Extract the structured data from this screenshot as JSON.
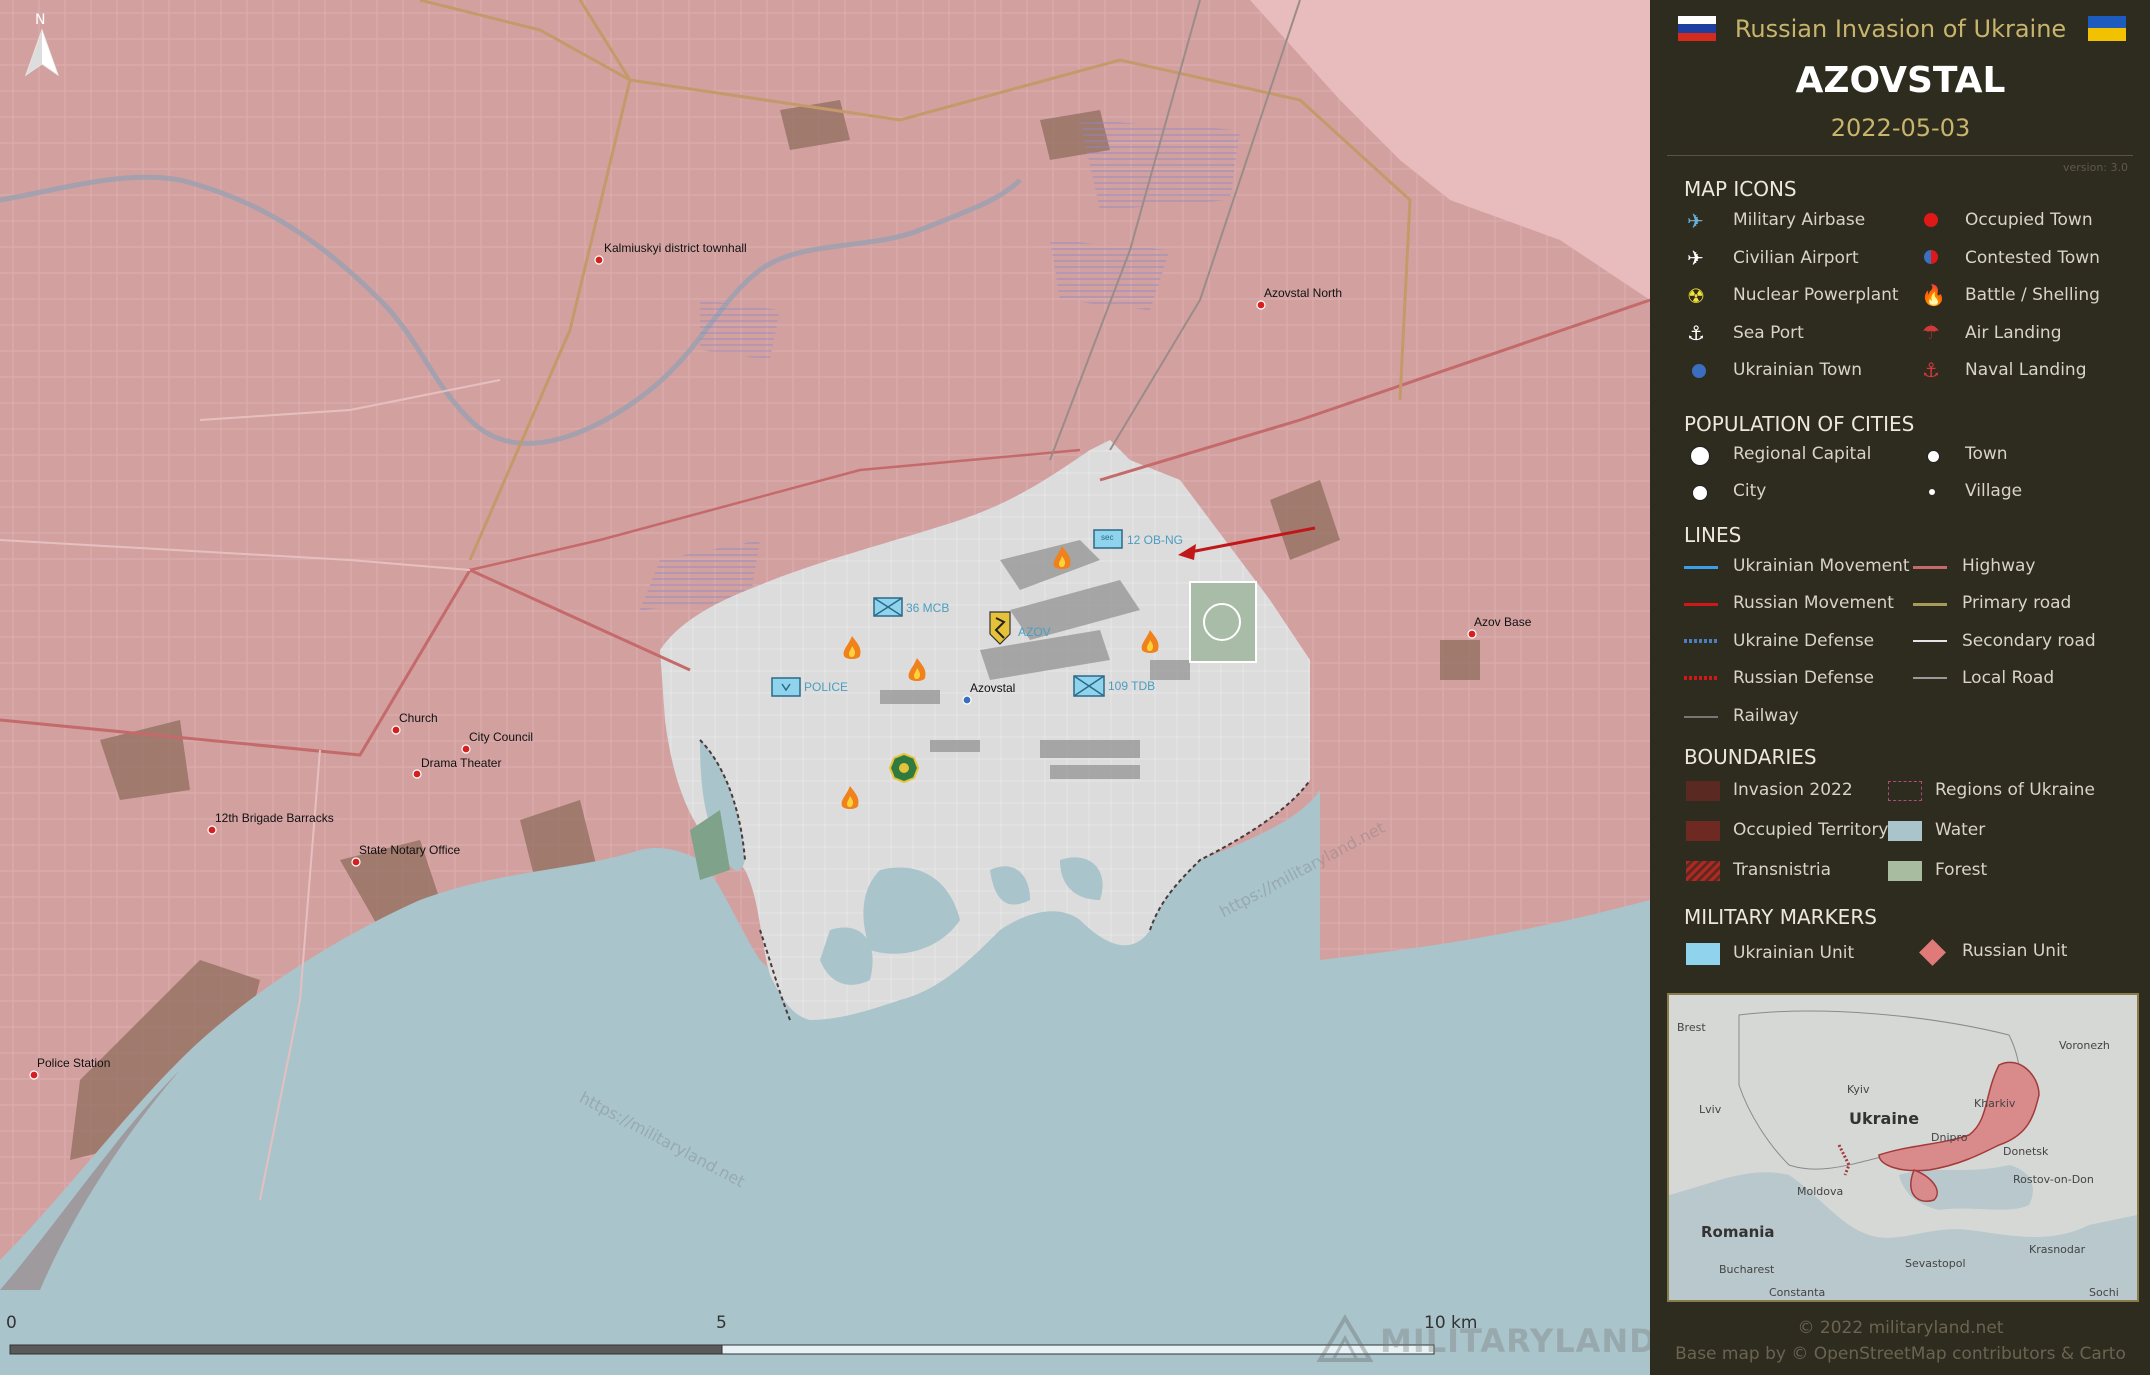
{
  "header": {
    "subtitle": "Russian Invasion of Ukraine",
    "title": "AZOVSTAL",
    "date": "2022-05-03",
    "version": "version: 3.0"
  },
  "colors": {
    "occupied": "#d3a0a0",
    "ukrainian_held": "#dcdcdc",
    "water": "#a9c4cb",
    "panel_bg": "#2e2b1f",
    "accent_gold": "#c8b56c",
    "ukraine_unit": "#8fd3ec",
    "russian_unit": "#e07a78"
  },
  "compass": {
    "label": "N"
  },
  "map_labels": [
    {
      "text": "Kalmiuskyi district townhall"
    },
    {
      "text": "Azovstal North"
    },
    {
      "text": "Azov Base"
    },
    {
      "text": "Church"
    },
    {
      "text": "City Council"
    },
    {
      "text": "Drama Theater"
    },
    {
      "text": "12th Brigade Barracks"
    },
    {
      "text": "State Notary Office"
    },
    {
      "text": "Police Station"
    },
    {
      "text": "Azovstal"
    }
  ],
  "units": [
    {
      "text": "36 MCB"
    },
    {
      "text": "AZOV"
    },
    {
      "text": "POLICE"
    },
    {
      "text": "109 TDB"
    },
    {
      "text": "12 OB-NG"
    },
    {
      "text": "sec"
    }
  ],
  "watermarks": [
    "https://militaryland.net",
    "https://militaryland.net"
  ],
  "scale": {
    "labels": [
      "0",
      "5",
      "10 km"
    ]
  },
  "brand": {
    "text": "MILITARYLAND"
  },
  "legend": {
    "map_icons": {
      "title": "MAP ICONS",
      "items": [
        {
          "label": "Military Airbase",
          "icon": "military-airbase-icon"
        },
        {
          "label": "Civilian Airport",
          "icon": "civilian-airport-icon"
        },
        {
          "label": "Nuclear Powerplant",
          "icon": "nuclear-icon"
        },
        {
          "label": "Sea Port",
          "icon": "anchor-icon"
        },
        {
          "label": "Ukrainian Town",
          "icon": "ukrainian-town-icon"
        },
        {
          "label": "Occupied Town",
          "icon": "occupied-town-icon"
        },
        {
          "label": "Contested Town",
          "icon": "contested-town-icon"
        },
        {
          "label": "Battle / Shelling",
          "icon": "fire-icon"
        },
        {
          "label": "Air Landing",
          "icon": "parachute-icon"
        },
        {
          "label": "Naval Landing",
          "icon": "naval-anchor-icon"
        }
      ]
    },
    "population": {
      "title": "POPULATION OF CITIES",
      "items": [
        {
          "label": "Regional Capital"
        },
        {
          "label": "City"
        },
        {
          "label": "Town"
        },
        {
          "label": "Village"
        }
      ]
    },
    "lines": {
      "title": "LINES",
      "items": [
        {
          "label": "Ukrainian Movement"
        },
        {
          "label": "Russian Movement"
        },
        {
          "label": "Ukraine Defense"
        },
        {
          "label": "Russian Defense"
        },
        {
          "label": "Railway"
        },
        {
          "label": "Highway"
        },
        {
          "label": "Primary road"
        },
        {
          "label": "Secondary road"
        },
        {
          "label": "Local Road"
        }
      ]
    },
    "boundaries": {
      "title": "BOUNDARIES",
      "items": [
        {
          "label": "Invasion 2022"
        },
        {
          "label": "Occupied Territory"
        },
        {
          "label": "Transnistria"
        },
        {
          "label": "Regions of Ukraine"
        },
        {
          "label": "Water"
        },
        {
          "label": "Forest"
        }
      ]
    },
    "markers": {
      "title": "MILITARY MARKERS",
      "items": [
        {
          "label": "Ukrainian Unit"
        },
        {
          "label": "Russian Unit"
        }
      ]
    }
  },
  "inset": {
    "labels": [
      "Brest",
      "Voronezh",
      "Kyiv",
      "Kharkiv",
      "Lviv",
      "Ukraine",
      "Dnipro",
      "Donetsk",
      "Moldova",
      "Rostov-on-Don",
      "Romania",
      "Krasnodar",
      "Bucharest",
      "Sevastopol",
      "Constanta",
      "Sochi"
    ]
  },
  "footer": {
    "copyright": "© 2022 militaryland.net",
    "basemap": "Base map by © OpenStreetMap contributors & Carto"
  }
}
